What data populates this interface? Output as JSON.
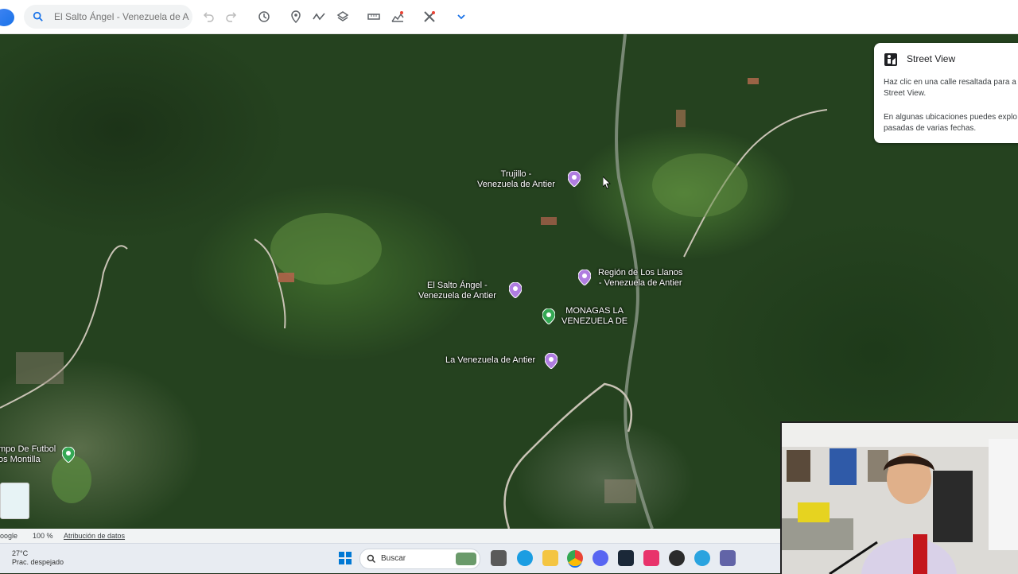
{
  "toolbar": {
    "search_placeholder": "El Salto Ángel - Venezuela de Antier",
    "icons": [
      "search-icon",
      "undo-icon",
      "redo-icon",
      "history-icon",
      "pin-icon",
      "path-icon",
      "layers-icon",
      "ruler-icon",
      "image-chart-icon",
      "tools-icon",
      "chevron-down-icon"
    ]
  },
  "map": {
    "places": [
      {
        "name": "Trujillo -\nVenezuela de Antier",
        "color": "#b07de0"
      },
      {
        "name": "Región de Los Llanos\n- Venezuela de Antier",
        "color": "#b07de0"
      },
      {
        "name": "El Salto Ángel -\nVenezuela de Antier",
        "color": "#b07de0"
      },
      {
        "name": "MONAGAS LA\nVENEZUELA DE",
        "color": "#34a853"
      },
      {
        "name": "La Venezuela de Antier",
        "color": "#b07de0"
      },
      {
        "name": "mpo De Futbol\nos Montilla",
        "color": "#34a853"
      }
    ]
  },
  "street_view": {
    "title": "Street View",
    "text1": "Haz clic en una calle resaltada para a Street View.",
    "text2": "En algunas ubicaciones puedes explo pasadas de varias fechas."
  },
  "status": {
    "brand": "oogle",
    "zoom": "100 %",
    "attribution": "Atribución de datos"
  },
  "taskbar": {
    "temperature": "27°C",
    "condition": "Prac. despejado",
    "search_label": "Buscar"
  }
}
